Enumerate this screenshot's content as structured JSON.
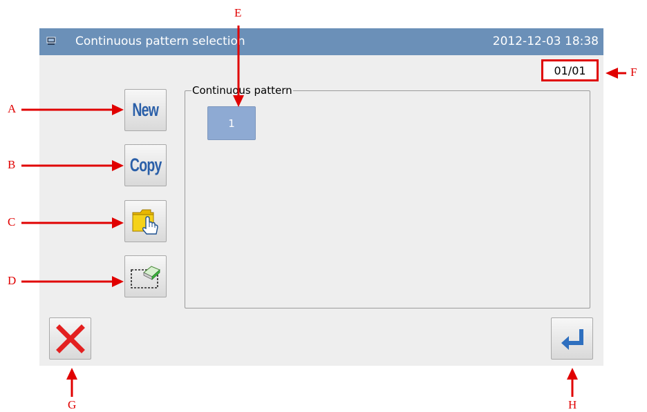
{
  "titlebar": {
    "title": "Continuous pattern selection",
    "datetime": "2012-12-03  18:38",
    "icon": "computer-icon"
  },
  "page_indicator": "01/01",
  "side_buttons": [
    {
      "label": "New",
      "icon": null
    },
    {
      "label": "Copy",
      "icon": null
    },
    {
      "label": "",
      "icon": "folder-hand-icon"
    },
    {
      "label": "",
      "icon": "eraser-icon"
    }
  ],
  "group": {
    "legend": "Continuous pattern",
    "items": [
      "1"
    ]
  },
  "bottom": {
    "cancel_icon": "close-icon",
    "enter_icon": "enter-icon"
  },
  "callouts": {
    "A": "A",
    "B": "B",
    "C": "C",
    "D": "D",
    "E": "E",
    "F": "F",
    "G": "G",
    "H": "H"
  },
  "colors": {
    "titlebar": "#6b90b8",
    "callout": "#e00000",
    "pattern_item": "#8eaad3",
    "button_text": "#2a5fa8"
  }
}
